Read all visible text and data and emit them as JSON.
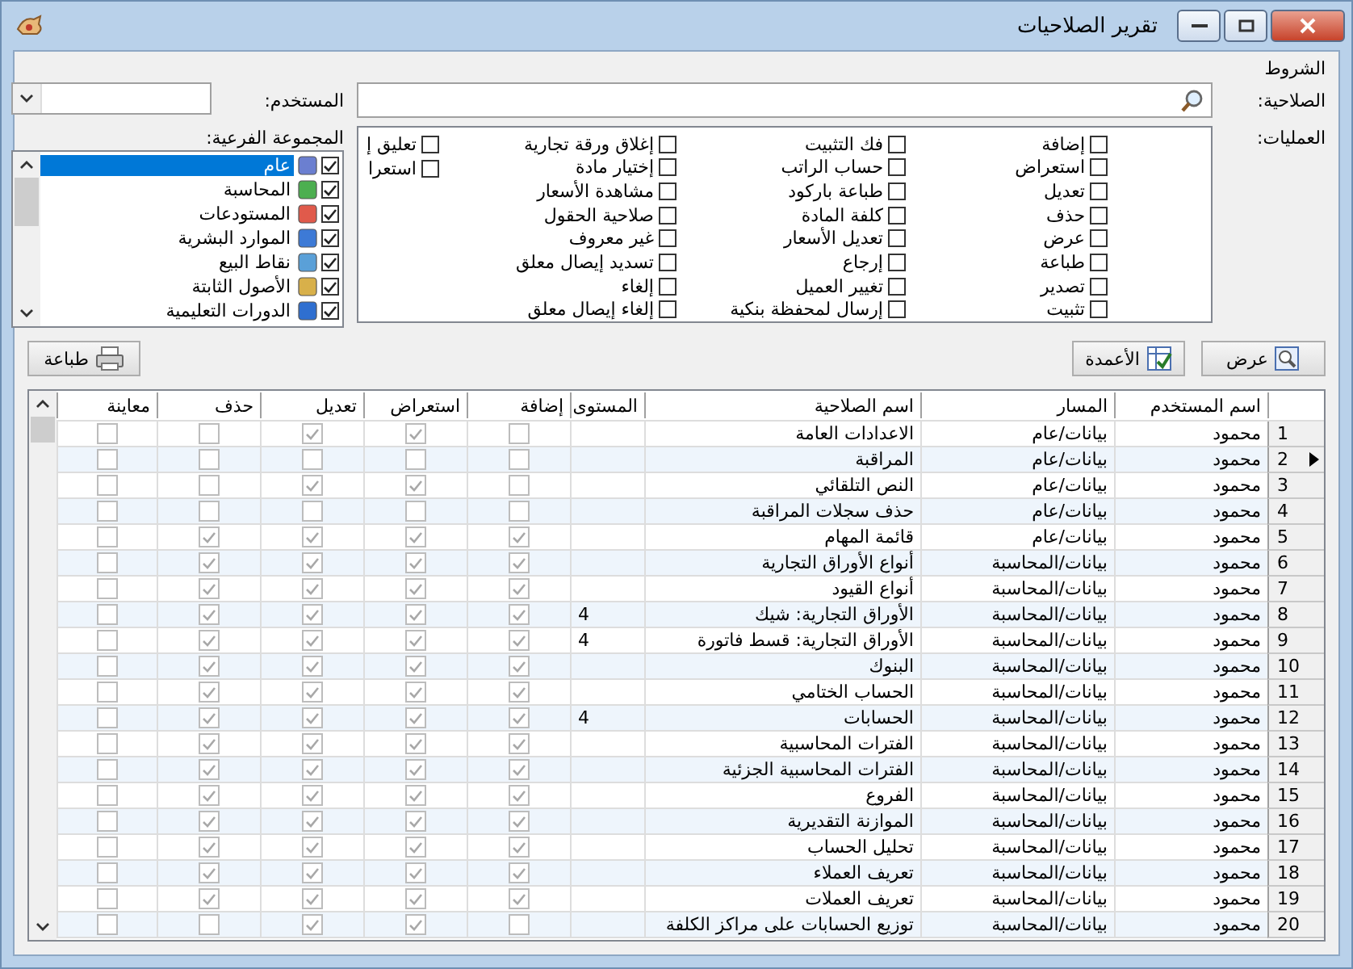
{
  "window": {
    "title": "تقرير الصلاحيات"
  },
  "conditions": {
    "title": "الشروط",
    "permission_label": "الصلاحية:",
    "user_label": "المستخدم:",
    "operations_label": "العمليات:",
    "subgroup_label": "المجموعة الفرعية:",
    "operation_columns": [
      {
        "items": [
          {
            "label": "إضافة",
            "checked": false
          },
          {
            "label": "استعراض",
            "checked": false
          },
          {
            "label": "تعديل",
            "checked": false
          },
          {
            "label": "حذف",
            "checked": false
          },
          {
            "label": "عرض",
            "checked": false
          },
          {
            "label": "طباعة",
            "checked": false
          },
          {
            "label": "تصدير",
            "checked": false
          },
          {
            "label": "تثبيت",
            "checked": false
          }
        ]
      },
      {
        "items": [
          {
            "label": "فك التثبيت",
            "checked": false
          },
          {
            "label": "حساب الراتب",
            "checked": false
          },
          {
            "label": "طباعة باركود",
            "checked": false
          },
          {
            "label": "كلفة المادة",
            "checked": false
          },
          {
            "label": "تعديل الأسعار",
            "checked": false
          },
          {
            "label": "إرجاع",
            "checked": false
          },
          {
            "label": "تغيير العميل",
            "checked": false
          },
          {
            "label": "إرسال لمحفظة بنكية",
            "checked": false
          }
        ]
      },
      {
        "items": [
          {
            "label": "إغلاق ورقة تجارية",
            "checked": false
          },
          {
            "label": "إختيار مادة",
            "checked": false
          },
          {
            "label": "مشاهدة الأسعار",
            "checked": false
          },
          {
            "label": "صلاحية الحقول",
            "checked": false
          },
          {
            "label": "غير معروف",
            "checked": false
          },
          {
            "label": "تسديد إيصال معلق",
            "checked": false
          },
          {
            "label": "إلغاء",
            "checked": false
          },
          {
            "label": "إلغاء إيصال معلق",
            "checked": false
          }
        ]
      },
      {
        "items": [
          {
            "label": "تعليق إ",
            "checked": false
          },
          {
            "label": "استعرا",
            "checked": false
          }
        ]
      }
    ],
    "subgroups": [
      {
        "label": "عام",
        "checked": true,
        "selected": true
      },
      {
        "label": "المحاسبة",
        "checked": true,
        "selected": false
      },
      {
        "label": "المستودعات",
        "checked": true,
        "selected": false
      },
      {
        "label": "الموارد البشرية",
        "checked": true,
        "selected": false
      },
      {
        "label": "نقاط البيع",
        "checked": true,
        "selected": false
      },
      {
        "label": "الأصول الثابتة",
        "checked": true,
        "selected": false
      },
      {
        "label": "الدورات التعليمية",
        "checked": true,
        "selected": false
      }
    ]
  },
  "buttons": [
    {
      "label": "عرض",
      "kind": "show"
    },
    {
      "label": "الأعمدة",
      "kind": "columns"
    },
    {
      "label": "طباعة",
      "kind": "print"
    }
  ],
  "grid": {
    "columns": [
      "اسم المستخدم",
      "المسار",
      "اسم الصلاحية",
      "المستوى",
      "إضافة",
      "استعراض",
      "تعديل",
      "حذف",
      "معاينة"
    ],
    "rows": [
      {
        "number": "1",
        "user": "محمود",
        "path": "بيانات/عام",
        "name": "الاعدادات العامة",
        "current": false,
        "add": false,
        "browse": true,
        "edit": true,
        "delete": false,
        "preview": false
      },
      {
        "number": "2",
        "user": "محمود",
        "path": "بيانات/عام",
        "name": "المراقبة",
        "current": true,
        "add": false,
        "browse": false,
        "edit": false,
        "delete": false,
        "preview": false
      },
      {
        "number": "3",
        "user": "محمود",
        "path": "بيانات/عام",
        "name": "النص التلقائي",
        "current": false,
        "add": false,
        "browse": true,
        "edit": true,
        "delete": false,
        "preview": false
      },
      {
        "number": "4",
        "user": "محمود",
        "path": "بيانات/عام",
        "name": "حذف سجلات المراقبة",
        "current": false,
        "add": false,
        "browse": false,
        "edit": false,
        "delete": false,
        "preview": false
      },
      {
        "number": "5",
        "user": "محمود",
        "path": "بيانات/عام",
        "name": "قائمة المهام",
        "current": false,
        "add": true,
        "browse": true,
        "edit": true,
        "delete": true,
        "preview": false
      },
      {
        "number": "6",
        "user": "محمود",
        "path": "بيانات/المحاسبة",
        "name": "أنواع الأوراق التجارية",
        "current": false,
        "add": true,
        "browse": true,
        "edit": true,
        "delete": true,
        "preview": false
      },
      {
        "number": "7",
        "user": "محمود",
        "path": "بيانات/المحاسبة",
        "name": "أنواع القيود",
        "current": false,
        "add": true,
        "browse": true,
        "edit": true,
        "delete": true,
        "preview": false
      },
      {
        "number": "8",
        "user": "محمود",
        "path": "بيانات/المحاسبة",
        "name": "الأوراق التجارية: شيك",
        "rank": "4",
        "current": false,
        "add": true,
        "browse": true,
        "edit": true,
        "delete": true,
        "preview": false
      },
      {
        "number": "9",
        "user": "محمود",
        "path": "بيانات/المحاسبة",
        "name": "الأوراق التجارية: قسط فاتورة",
        "rank": "4",
        "current": false,
        "add": true,
        "browse": true,
        "edit": true,
        "delete": true,
        "preview": false
      },
      {
        "number": "10",
        "user": "محمود",
        "path": "بيانات/المحاسبة",
        "name": "البنوك",
        "current": false,
        "add": true,
        "browse": true,
        "edit": true,
        "delete": true,
        "preview": false
      },
      {
        "number": "11",
        "user": "محمود",
        "path": "بيانات/المحاسبة",
        "name": "الحساب الختامي",
        "current": false,
        "add": true,
        "browse": true,
        "edit": true,
        "delete": true,
        "preview": false
      },
      {
        "number": "12",
        "user": "محمود",
        "path": "بيانات/المحاسبة",
        "name": "الحسابات",
        "rank": "4",
        "current": false,
        "add": true,
        "browse": true,
        "edit": true,
        "delete": true,
        "preview": false
      },
      {
        "number": "13",
        "user": "محمود",
        "path": "بيانات/المحاسبة",
        "name": "الفترات المحاسبية",
        "current": false,
        "add": true,
        "browse": true,
        "edit": true,
        "delete": true,
        "preview": false
      },
      {
        "number": "14",
        "user": "محمود",
        "path": "بيانات/المحاسبة",
        "name": "الفترات المحاسبية الجزئية",
        "current": false,
        "add": true,
        "browse": true,
        "edit": true,
        "delete": true,
        "preview": false
      },
      {
        "number": "15",
        "user": "محمود",
        "path": "بيانات/المحاسبة",
        "name": "الفروع",
        "current": false,
        "add": true,
        "browse": true,
        "edit": true,
        "delete": true,
        "preview": false
      },
      {
        "number": "16",
        "user": "محمود",
        "path": "بيانات/المحاسبة",
        "name": "الموازنة التقديرية",
        "current": false,
        "add": true,
        "browse": true,
        "edit": true,
        "delete": true,
        "preview": false
      },
      {
        "number": "17",
        "user": "محمود",
        "path": "بيانات/المحاسبة",
        "name": "تحليل الحساب",
        "current": false,
        "add": true,
        "browse": true,
        "edit": true,
        "delete": true,
        "preview": false
      },
      {
        "number": "18",
        "user": "محمود",
        "path": "بيانات/المحاسبة",
        "name": "تعريف العملاء",
        "current": false,
        "add": true,
        "browse": true,
        "edit": true,
        "delete": true,
        "preview": false
      },
      {
        "number": "19",
        "user": "محمود",
        "path": "بيانات/المحاسبة",
        "name": "تعريف العملات",
        "current": false,
        "add": true,
        "browse": true,
        "edit": true,
        "delete": true,
        "preview": false
      },
      {
        "number": "20",
        "user": "محمود",
        "path": "بيانات/المحاسبة",
        "name": "توزيع الحسابات على مراكز الكلفة",
        "current": false,
        "add": false,
        "browse": true,
        "edit": true,
        "delete": false,
        "preview": false
      }
    ]
  }
}
